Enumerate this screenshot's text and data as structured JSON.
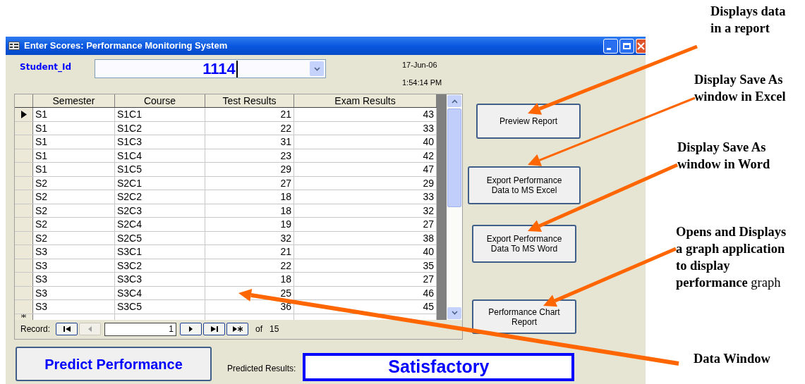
{
  "window": {
    "title": "Enter Scores: Performance Monitoring System"
  },
  "student_id": {
    "label": "Student_Id",
    "value": "1114"
  },
  "date": "17-Jun-06",
  "time": "1:54:14 PM",
  "table": {
    "columns": [
      "Semester",
      "Course",
      "Test Results",
      "Exam Results"
    ],
    "rows": [
      {
        "cells": [
          "S1",
          "S1C1",
          "21",
          "43"
        ],
        "selected": true
      },
      {
        "cells": [
          "S1",
          "S1C2",
          "22",
          "33"
        ],
        "selected": false
      },
      {
        "cells": [
          "S1",
          "S1C3",
          "31",
          "40"
        ],
        "selected": false
      },
      {
        "cells": [
          "S1",
          "S1C4",
          "23",
          "42"
        ],
        "selected": false
      },
      {
        "cells": [
          "S1",
          "S1C5",
          "29",
          "47"
        ],
        "selected": false
      },
      {
        "cells": [
          "S2",
          "S2C1",
          "27",
          "29"
        ],
        "selected": false
      },
      {
        "cells": [
          "S2",
          "S2C2",
          "18",
          "33"
        ],
        "selected": false
      },
      {
        "cells": [
          "S2",
          "S2C3",
          "18",
          "32"
        ],
        "selected": false
      },
      {
        "cells": [
          "S2",
          "S2C4",
          "19",
          "27"
        ],
        "selected": false
      },
      {
        "cells": [
          "S2",
          "S2C5",
          "32",
          "38"
        ],
        "selected": false
      },
      {
        "cells": [
          "S3",
          "S3C1",
          "21",
          "40"
        ],
        "selected": false
      },
      {
        "cells": [
          "S3",
          "S3C2",
          "22",
          "35"
        ],
        "selected": false
      },
      {
        "cells": [
          "S3",
          "S3C3",
          "18",
          "27"
        ],
        "selected": false
      },
      {
        "cells": [
          "S3",
          "S3C4",
          "25",
          "46"
        ],
        "selected": false
      },
      {
        "cells": [
          "S3",
          "S3C5",
          "36",
          "45"
        ],
        "selected": false
      }
    ]
  },
  "record_nav": {
    "label": "Record:",
    "current": "1",
    "of": "of",
    "total": "15",
    "buttons": [
      {
        "kind": "first",
        "disabled": false
      },
      {
        "kind": "prev",
        "disabled": true
      },
      {
        "kind": "next",
        "disabled": false
      },
      {
        "kind": "last",
        "disabled": false
      },
      {
        "kind": "new",
        "disabled": false
      }
    ]
  },
  "side_buttons": [
    {
      "label": "Preview Report"
    },
    {
      "label": "Export Performance Data  to MS Excel"
    },
    {
      "label": "Export Performance Data To MS Word"
    },
    {
      "label": "Performance Chart Report"
    }
  ],
  "predict_button": "Predict Performance",
  "predicted_results": {
    "label": "Predicted Results:",
    "value": "Satisfactory"
  },
  "annotations": [
    {
      "lines": [
        "Displays data",
        "in a report"
      ]
    },
    {
      "lines": [
        "Display Save As",
        "window in Excel"
      ]
    },
    {
      "lines": [
        "Display Save As",
        "window in Word"
      ]
    },
    {
      "lines": [
        "Opens and Displays",
        "a graph application",
        "to display",
        "**performance** graph"
      ]
    },
    {
      "lines": [
        "Data Window"
      ]
    }
  ]
}
